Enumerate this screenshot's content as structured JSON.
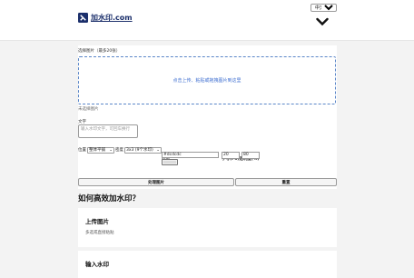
{
  "header": {
    "site_name": "加水印.com",
    "language": "中文",
    "language_options": [
      "中文"
    ]
  },
  "form": {
    "select_image_label": "选择图片（最多20张）",
    "dropzone_text": "点击上传、粘贴或拖拽图片到这里",
    "no_image_status": "未选择图片",
    "text_label": "文字",
    "text_placeholder": "输入水印文字，可回车换行",
    "position_label": "位置",
    "position_value": "整体平铺",
    "density_label": "密度",
    "density_value": "3x3 (9个水印)",
    "color_label": "颜色",
    "color_value": "#dcdcdc",
    "size_label": "字号(Px)",
    "size_value": "20",
    "opacity_label": "透明度(%)",
    "opacity_value": "80",
    "process_button": "处理图片",
    "reset_button": "重置"
  },
  "how_to": {
    "title": "如何高效加水印？",
    "steps": [
      {
        "title": "上传图片",
        "desc": "多选或直接粘贴"
      },
      {
        "title": "输入水印",
        "desc": ""
      }
    ]
  },
  "colors": {
    "logo_text": "#1b2f6b",
    "dropzone_border": "#5a86c8",
    "dropzone_text": "#3f6fd1",
    "page_background": "#f3f3f3"
  }
}
